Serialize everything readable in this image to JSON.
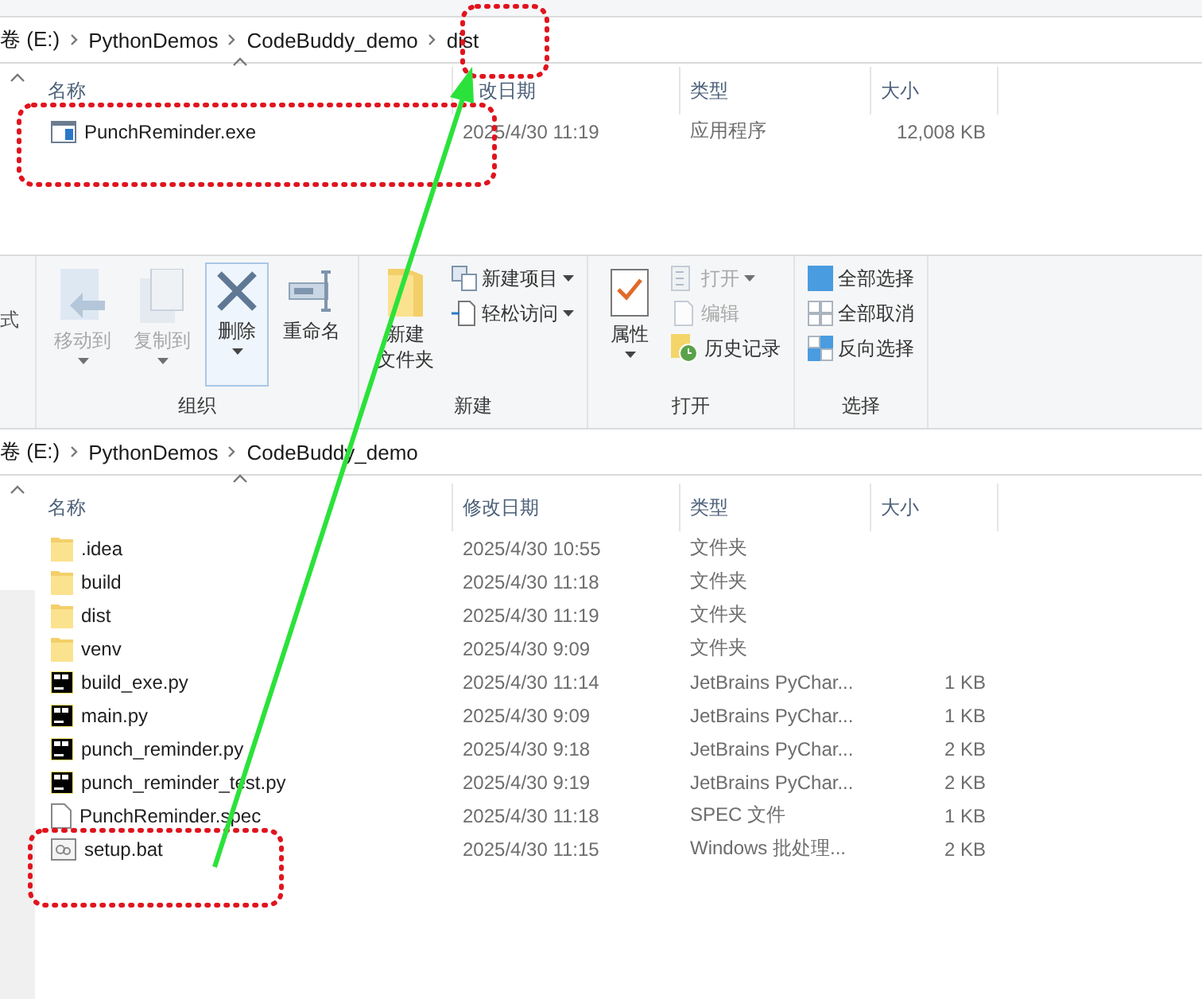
{
  "top_window": {
    "address": [
      "卷 (E:)",
      "PythonDemos",
      "CodeBuddy_demo",
      "dist"
    ],
    "columns": [
      "名称",
      "改日期",
      "类型",
      "大小"
    ],
    "files": [
      {
        "kind": "exe",
        "name": "PunchReminder.exe",
        "date": "2025/4/30 11:19",
        "type": "应用程序",
        "size": "12,008 KB"
      }
    ]
  },
  "ribbon": {
    "groups": [
      {
        "items": [
          {
            "kind": "text",
            "label": "式"
          }
        ]
      },
      {
        "label": "组织",
        "items": [
          {
            "kind": "large",
            "label": "移动到",
            "disabled": true,
            "dropdown": true
          },
          {
            "kind": "large",
            "label": "复制到",
            "disabled": true,
            "dropdown": true
          },
          {
            "kind": "large",
            "label": "删除",
            "disabled": false,
            "hovered": true,
            "dropdown": true
          },
          {
            "kind": "large",
            "label": "重命名",
            "disabled": false
          }
        ]
      },
      {
        "label": "新建",
        "items": [
          {
            "kind": "large",
            "label": "新建",
            "label_2": "文件夹",
            "disabled": false
          },
          {
            "kind": "small",
            "label": "新建项目",
            "disabled": false,
            "dropdown": true
          },
          {
            "kind": "small",
            "label": "轻松访问",
            "disabled": false,
            "dropdown": true
          }
        ]
      },
      {
        "label": "打开",
        "items": [
          {
            "kind": "large",
            "label": "属性",
            "disabled": false,
            "dropdown": true
          },
          {
            "kind": "small",
            "label": "打开",
            "disabled": true,
            "dropdown": true
          },
          {
            "kind": "small",
            "label": "编辑",
            "disabled": true
          },
          {
            "kind": "small",
            "label": "历史记录",
            "disabled": false
          }
        ]
      },
      {
        "label": "选择",
        "items": [
          {
            "kind": "small",
            "label": "全部选择",
            "disabled": false
          },
          {
            "kind": "small",
            "label": "全部取消",
            "disabled": false
          },
          {
            "kind": "small",
            "label": "反向选择",
            "disabled": false
          }
        ]
      }
    ]
  },
  "bottom_window": {
    "address": [
      "卷 (E:)",
      "PythonDemos",
      "CodeBuddy_demo"
    ],
    "columns": [
      "名称",
      "修改日期",
      "类型",
      "大小"
    ],
    "files": [
      {
        "kind": "folder",
        "name": ".idea",
        "date": "2025/4/30 10:55",
        "type": "文件夹"
      },
      {
        "kind": "folder",
        "name": "build",
        "date": "2025/4/30 11:18",
        "type": "文件夹"
      },
      {
        "kind": "folder",
        "name": "dist",
        "date": "2025/4/30 11:19",
        "type": "文件夹"
      },
      {
        "kind": "folder",
        "name": "venv",
        "date": "2025/4/30 9:09",
        "type": "文件夹"
      },
      {
        "kind": "python",
        "name": "build_exe.py",
        "date": "2025/4/30 11:14",
        "type": "JetBrains PyChar...",
        "size": "1 KB"
      },
      {
        "kind": "python",
        "name": "main.py",
        "date": "2025/4/30 9:09",
        "type": "JetBrains PyChar...",
        "size": "1 KB"
      },
      {
        "kind": "python",
        "name": "punch_reminder.py",
        "date": "2025/4/30 9:18",
        "type": "JetBrains PyChar...",
        "size": "2 KB"
      },
      {
        "kind": "python",
        "name": "punch_reminder_test.py",
        "date": "2025/4/30 9:19",
        "type": "JetBrains PyChar...",
        "size": "2 KB"
      },
      {
        "kind": "spec",
        "name": "PunchReminder.spec",
        "date": "2025/4/30 11:18",
        "type": "SPEC 文件",
        "size": "1 KB"
      },
      {
        "kind": "batch",
        "name": "setup.bat",
        "date": "2025/4/30 11:15",
        "type": "Windows 批处理...",
        "size": "2 KB"
      }
    ]
  }
}
